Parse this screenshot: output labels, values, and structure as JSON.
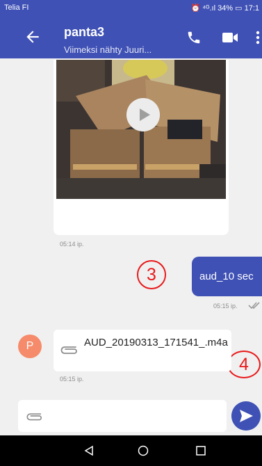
{
  "status_bar": {
    "carrier": "Telia FI",
    "indicators": "⏰ ⁴ᴳ.ıl 34% ▭ 17:1"
  },
  "app_bar": {
    "title": "panta3",
    "subtitle": "Viimeksi nähty Juuri...",
    "icons": [
      "back-arrow-icon",
      "phone-icon",
      "video-camera-icon",
      "more-vertical-icon"
    ]
  },
  "messages": [
    {
      "type": "incoming-video",
      "time": "05:14 ip."
    },
    {
      "type": "outgoing-text",
      "text": "aud_10 sec",
      "time": "05:15 ip.",
      "status": "read"
    },
    {
      "type": "incoming-file",
      "sender_initial": "P",
      "file_name": "AUD_20190313_171541_.m4a",
      "time": "05:15 ip."
    }
  ],
  "annotations": [
    "3",
    "4"
  ],
  "composer": {
    "placeholder": ""
  },
  "colors": {
    "primary": "#3f51b5",
    "avatar": "#f58b6b",
    "annotation": "#e8191b",
    "background": "#f0f0f0"
  }
}
